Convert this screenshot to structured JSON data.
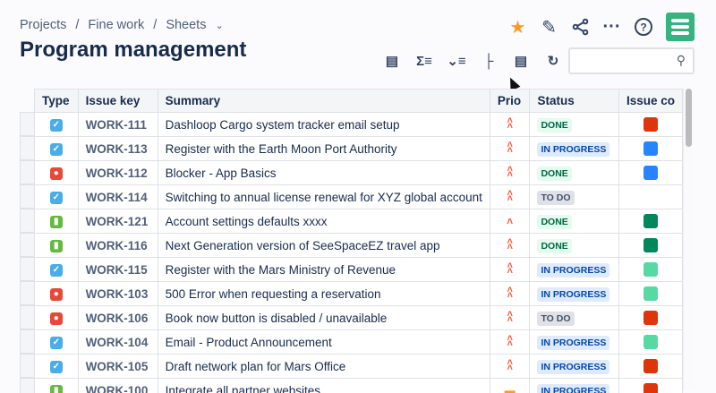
{
  "breadcrumb": [
    "Projects",
    "Fine work",
    "Sheets"
  ],
  "title": "Program management",
  "search": {
    "placeholder": ""
  },
  "columns": [
    "Type",
    "Issue key",
    "Summary",
    "Prio",
    "Status",
    "Issue co"
  ],
  "colors": {
    "story": "#4bade8",
    "bug": "#e5493a",
    "feature": "#63ba3c",
    "done_bg": "#e3fcef",
    "done_fg": "#006644",
    "prog_bg": "#deebff",
    "prog_fg": "#0747a6",
    "todo_bg": "#dfe1e6",
    "todo_fg": "#42526e",
    "prio": "#ff5630"
  },
  "rows": [
    {
      "type": "task",
      "key": "WORK-111",
      "summary": "Dashloop Cargo system tracker email setup",
      "prio": "highest",
      "status": "DONE",
      "color": "#de350b"
    },
    {
      "type": "task",
      "key": "WORK-113",
      "summary": "Register with the Earth Moon Port Authority",
      "prio": "highest",
      "status": "IN PROGRESS",
      "color": "#2684ff"
    },
    {
      "type": "bug",
      "key": "WORK-112",
      "summary": "Blocker - App Basics",
      "prio": "highest",
      "status": "DONE",
      "color": "#2684ff"
    },
    {
      "type": "task",
      "key": "WORK-114",
      "summary": "Switching to annual license renewal for XYZ global account",
      "prio": "highest",
      "status": "TO DO",
      "color": ""
    },
    {
      "type": "story",
      "key": "WORK-121",
      "summary": "Account settings defaults xxxx",
      "prio": "high",
      "status": "DONE",
      "color": "#00875a"
    },
    {
      "type": "story",
      "key": "WORK-116",
      "summary": "Next Generation version of SeeSpaceEZ travel app",
      "prio": "highest",
      "status": "DONE",
      "color": "#00875a"
    },
    {
      "type": "task",
      "key": "WORK-115",
      "summary": "Register with the Mars Ministry of Revenue",
      "prio": "highest",
      "status": "IN PROGRESS",
      "color": "#57d9a3"
    },
    {
      "type": "bug",
      "key": "WORK-103",
      "summary": "500 Error when requesting a reservation",
      "prio": "highest",
      "status": "IN PROGRESS",
      "color": "#57d9a3"
    },
    {
      "type": "bug",
      "key": "WORK-106",
      "summary": "Book now button is disabled / unavailable",
      "prio": "highest",
      "status": "TO DO",
      "color": "#de350b"
    },
    {
      "type": "task",
      "key": "WORK-104",
      "summary": "Email - Product Announcement",
      "prio": "highest",
      "status": "IN PROGRESS",
      "color": "#57d9a3"
    },
    {
      "type": "task",
      "key": "WORK-105",
      "summary": "Draft network plan for Mars Office",
      "prio": "highest",
      "status": "IN PROGRESS",
      "color": "#de350b"
    },
    {
      "type": "story",
      "key": "WORK-100",
      "summary": "Integrate all partner websites",
      "prio": "medium",
      "status": "IN PROGRESS",
      "color": "#de350b"
    }
  ]
}
